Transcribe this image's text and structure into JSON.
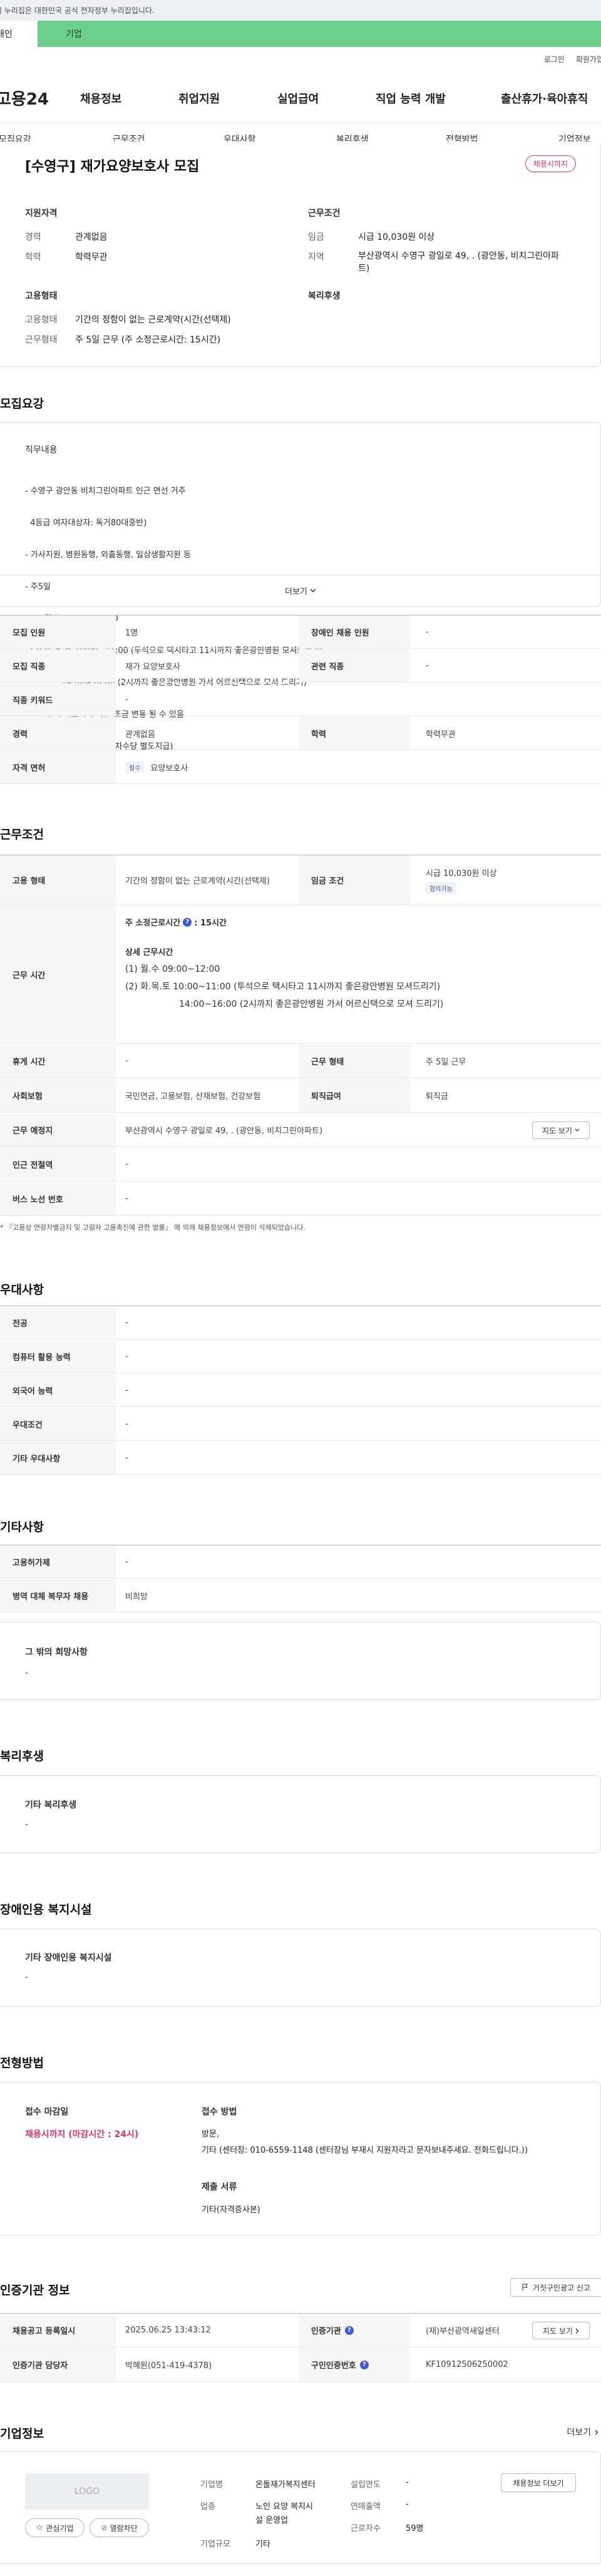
{
  "gov_bar": "이 누리집은 대한민국 공식 전자정부 누리집입니다.",
  "top_tabs": {
    "person": "개인",
    "company": "기업"
  },
  "util": {
    "login": "로그인",
    "signup": "회원가입"
  },
  "logo": "고용24",
  "gnb": [
    "채용정보",
    "취업지원",
    "실업급여",
    "직업 능력 개발",
    "출산휴가·육아휴직"
  ],
  "subnav": [
    "모집요강",
    "근무조건",
    "우대사항",
    "복리후생",
    "전형방법",
    "기업정보"
  ],
  "job": {
    "title": "[수영구] 재가요양보호사 모집",
    "status": "채용시까지",
    "qual_h": "지원자격",
    "cond_h": "근무조건",
    "career_l": "경력",
    "career_v": "관계없음",
    "edu_l": "학력",
    "edu_v": "학력무관",
    "wage_l": "임금",
    "wage_v": "시급 10,030원 이상",
    "area_l": "지역",
    "area_v1": "부산광역시 수영구 광일로 49, . (광안동, 비치그린아파",
    "area_v2": "트)",
    "emp_h": "고용형태",
    "welfare_h": "복리후생",
    "emptype_l": "고용형태",
    "emptype_v": "기간의 정함이 없는 근로계약(시간(선택제)",
    "worktype_l": "근무형태",
    "worktype_v": "주 5일 근무 (주 소정근로시간: 15시간)"
  },
  "recruit": {
    "heading": "모집요강",
    "duty_h": "직무내용",
    "lines": [
      "- 수영구 광안동 비치그린아파트 인근 면선 거주",
      "  4등급 여자대상자: 독거80대중반)",
      "- 가사지원, 병원동행, 외출동행, 일상생활지원 등",
      "- 주5일",
      "  (1) 월.수 09:00~12:00",
      "  (2) 화.목.토 10:00~11:00 (투석으로 택시타고 11시까지 좋은광안병원 모셔드리기)",
      "              14:00~16:00 (2시까지 좋은광안병원 가서 어르신택으로 모셔 드리기)",
      "    ** 투석 치료이라 시간 조금 변동 될 수 있음",
      "- 시급 10,030원 (주휴,연차수당 별도지급)"
    ],
    "more": "더보기",
    "table": [
      {
        "l1": "모집 인원",
        "v1": "1명",
        "l2": "장애인 채용 인원",
        "v2": "-"
      },
      {
        "l1": "모집 직종",
        "v1": "재가 요양보호사",
        "l2": "관련 직종",
        "v2": "-"
      },
      {
        "l1": "직종 키워드",
        "v1": "-"
      },
      {
        "l1": "경력",
        "v1": "관계없음",
        "l2": "학력",
        "v2": "학력무관"
      },
      {
        "l1": "자격 면허",
        "tag": "필수",
        "v1": "요양보호사"
      }
    ]
  },
  "cond": {
    "heading": "근무조건",
    "emptype_l": "고용 형태",
    "emptype_v": "기간의 정함이 없는 근로계약(시간(선택제)",
    "wage_l": "임금 조건",
    "wage_v": "시급 10,030원 이상",
    "wage_tag": "협의가능",
    "hours_l": "근무 시간",
    "hours_main": "주 소정근로시간",
    "hours_val": ": 15시간",
    "detail_h": "상세 근무시간",
    "detail": [
      "(1) 월.수 09:00~12:00",
      "(2) 화.목.토 10:00~11:00 (투석으로 택시타고 11시까지 좋은광안병원 모셔드리기)",
      "14:00~16:00 (2시까지 좋은광안병원 가서 어르신택으로 모셔 드리기)"
    ],
    "rest_l": "휴게 시간",
    "rest_v": "-",
    "worktype_l": "근무 형태",
    "worktype_v": "주 5일 근무",
    "ins_l": "사회보험",
    "ins_v": "국민연금, 고용보험, 산재보험, 건강보험",
    "sev_l": "퇴직급여",
    "sev_v": "퇴직금",
    "place_l": "근무 예정지",
    "place_v": "부산광역시 수영구 광일로 49, . (광안동, 비치그린아파트)",
    "map_btn": "지도 보기",
    "sub_l": "인근 전철역",
    "sub_v": "-",
    "bus_l": "버스 노선 번호",
    "bus_v": "-",
    "note": "* 『고용상 연령차별금지 및 고령자 고용촉진에 관한 법률』 에 의해 채용정보에서 연령이 삭제되었습니다."
  },
  "pref": {
    "heading": "우대사항",
    "rows": [
      {
        "l": "전공",
        "v": "-"
      },
      {
        "l": "컴퓨터 활용 능력",
        "v": "-"
      },
      {
        "l": "외국어 능력",
        "v": "-"
      },
      {
        "l": "우대조건",
        "v": "-"
      },
      {
        "l": "기타 우대사항",
        "v": "-"
      }
    ]
  },
  "etc": {
    "heading": "기타사항",
    "rows": [
      {
        "l": "고용허가제",
        "v": "-"
      },
      {
        "l": "병역 대체 복무자 채용",
        "v": "비희망"
      }
    ],
    "other_h": "그 밖의 희망사항",
    "other_v": "-"
  },
  "welfare": {
    "heading": "복리후생",
    "sub": "기타 복리후생",
    "v": "-"
  },
  "disabled": {
    "heading": "장애인용 복지시설",
    "sub": "기타 장애인용 복지시설",
    "v": "-"
  },
  "process": {
    "heading": "전형방법",
    "deadline_h": "접수 마감일",
    "deadline_v": "채용시까지 (마감시간 : 24시)",
    "method_h": "접수 방법",
    "method_v1": "방문,",
    "method_v2": "기타 (센터장: 010-6559-1148 (센터장님 부재시 지원자라고 문자보내주세요. 전화드립니다.))",
    "docs_h": "제출 서류",
    "docs_v": "기타(자격증사본)"
  },
  "agency": {
    "heading": "인증기관 정보",
    "report_btn": "거짓구인광고 신고",
    "reg_l": "채용공고 등록일시",
    "reg_v": "2025.06.25 13:43:12",
    "inst_l": "인증기관",
    "inst_v": "(재)부산광역새일센터",
    "mgr_l": "인증기관 담당자",
    "mgr_v": "박혜원(051-419-4378)",
    "no_l": "구인인증번호",
    "no_v": "KF10912506250002",
    "map_btn": "지도 보기"
  },
  "company": {
    "heading": "기업정보",
    "more": "더보기",
    "logo": "LOGO",
    "fav_btn": "관심기업",
    "block_btn": "열람차단",
    "name_l": "기업명",
    "name_v": "온돌재가복지센터",
    "ind_l": "업종",
    "ind_v1": "노인 요양 복지시",
    "ind_v2": "설 운영업",
    "size_l": "기업규모",
    "size_v": "기타",
    "est_l": "설립연도",
    "est_v": "-",
    "sales_l": "연매출액",
    "sales_v": "-",
    "emp_l": "근로자수",
    "emp_v": "59명",
    "jobs_btn": "채용정보 더보기"
  }
}
